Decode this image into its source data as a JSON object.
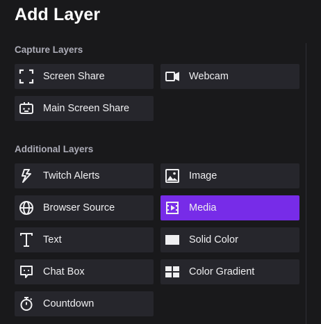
{
  "title": "Add Layer",
  "sections": {
    "capture": "Capture Layers",
    "additional": "Additional Layers"
  },
  "buttons": {
    "screen_share": "Screen Share",
    "webcam": "Webcam",
    "main_screen_share": "Main Screen Share",
    "twitch_alerts": "Twitch Alerts",
    "image": "Image",
    "browser_source": "Browser Source",
    "media": "Media",
    "text": "Text",
    "solid_color": "Solid Color",
    "chat_box": "Chat Box",
    "color_gradient": "Color Gradient",
    "countdown": "Countdown"
  },
  "selected": "media",
  "colors": {
    "background": "#19191b",
    "button": "#26262c",
    "accent": "#772ce8",
    "section_text": "#adadb8"
  }
}
